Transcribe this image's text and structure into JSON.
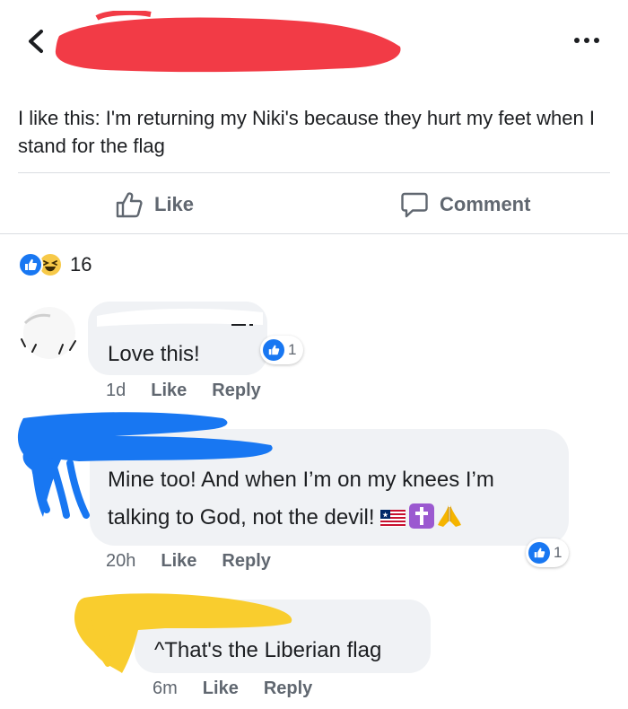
{
  "header": {
    "back_icon": "chevron-left-icon",
    "more_icon": "more-dots-icon",
    "redaction_color": "#f23b46"
  },
  "post": {
    "text": "I like this:  I'm returning my Niki's because they hurt my feet when I stand for the flag"
  },
  "actions": {
    "like_label": "Like",
    "comment_label": "Comment",
    "like_icon": "thumbs-up-outline-icon",
    "comment_icon": "speech-bubble-icon"
  },
  "reactions": {
    "count": "16",
    "types": [
      "like",
      "haha"
    ]
  },
  "comments": [
    {
      "text": "Love this!",
      "time": "1d",
      "like_label": "Like",
      "reply_label": "Reply",
      "likes": "1"
    },
    {
      "text_line1": "Mine too! And when I’m on my knees I’m",
      "text_line2": "talking to God, not the devil!",
      "emojis": [
        "liberia-flag-icon",
        "latin-cross-icon",
        "praying-hands-icon"
      ],
      "time": "20h",
      "like_label": "Like",
      "reply_label": "Reply",
      "likes": "1",
      "redaction_color": "#1877f2"
    },
    {
      "text": "^That's the Liberian flag",
      "time": "6m",
      "like_label": "Like",
      "reply_label": "Reply",
      "redaction_color": "#f9cd2e"
    }
  ],
  "colors": {
    "accent": "#1877f2",
    "meta_text": "#606770",
    "bubble": "#f0f2f5"
  }
}
